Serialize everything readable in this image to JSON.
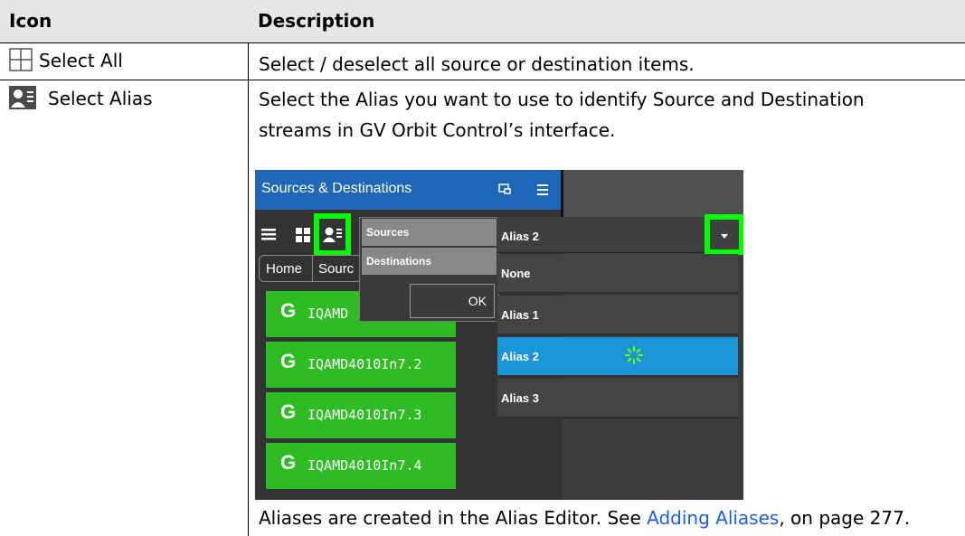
{
  "table": {
    "headers": {
      "icon": "Icon",
      "description": "Description"
    },
    "rows": [
      {
        "icon_label": "Select All",
        "description": "Select / deselect all source or destination items."
      },
      {
        "icon_label": "Select Alias",
        "description_line1": "Select the Alias you want to use to identify Source and Destination",
        "description_line2": "streams in GV Orbit Control’s interface."
      }
    ],
    "footer": {
      "before": "Aliases are created in the Alias Editor. See ",
      "link": "Adding Aliases",
      "after": ", on page 277."
    }
  },
  "screenshot": {
    "title": "Sources & Destinations",
    "breadcrumb": {
      "home": "Home",
      "current": "Sourc"
    },
    "items": [
      "IQAMD",
      "IQAMD4010In7.2",
      "IQAMD4010In7.3",
      "IQAMD4010In7.4"
    ],
    "popup": {
      "options": [
        "Sources",
        "Destinations"
      ],
      "ok": "OK"
    },
    "dropdown": {
      "selected": "Alias 2",
      "options": [
        "None",
        "Alias 1",
        "Alias 2",
        "Alias 3"
      ],
      "highlighted_index": 2
    }
  },
  "colors": {
    "accent_green": "#2ebb23",
    "title_blue": "#1f67b6",
    "highlight_blue": "#1a96d6",
    "callout_green": "#00ff00",
    "link_blue": "#1b5eea"
  },
  "icons": [
    "select-all-icon",
    "select-alias-icon",
    "list-view-icon",
    "grid-view-icon",
    "source-icon",
    "spinner-icon",
    "dropdown-caret-icon",
    "window-icon",
    "menu-icon"
  ]
}
